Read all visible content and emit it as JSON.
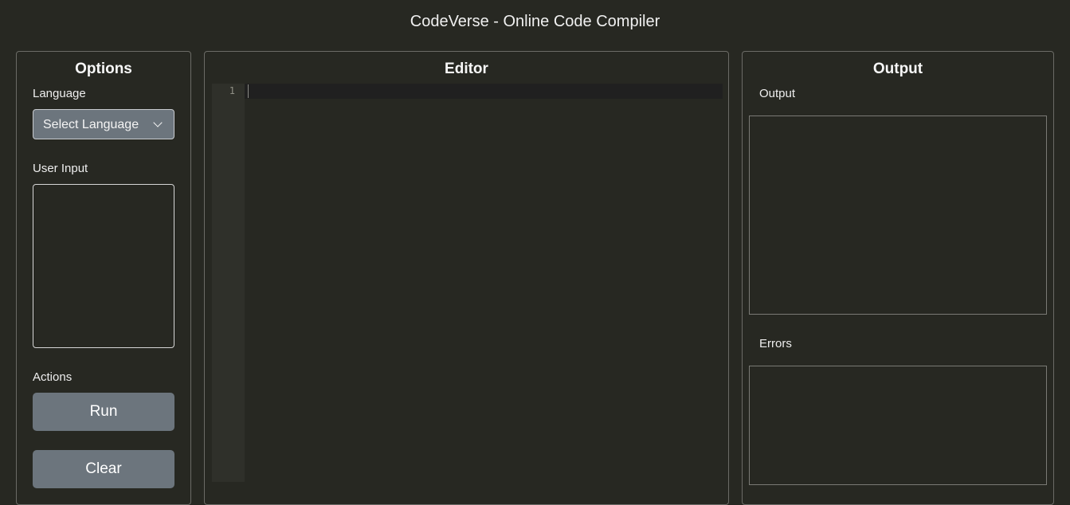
{
  "app": {
    "title": "CodeVerse - Online Code Compiler"
  },
  "options": {
    "title": "Options",
    "language_label": "Language",
    "language_select": "Select Language",
    "user_input_label": "User Input",
    "user_input_value": "",
    "actions_label": "Actions",
    "run_label": "Run",
    "clear_label": "Clear"
  },
  "editor": {
    "title": "Editor",
    "line_numbers": [
      "1"
    ],
    "code": ""
  },
  "output": {
    "title": "Output",
    "output_label": "Output",
    "output_text": "",
    "errors_label": "Errors",
    "errors_text": ""
  },
  "colors": {
    "background": "#272822",
    "button": "#6c757d",
    "panel_border": "#6b6b66"
  },
  "icons": {
    "language_dropdown": "chevron-down-icon"
  }
}
